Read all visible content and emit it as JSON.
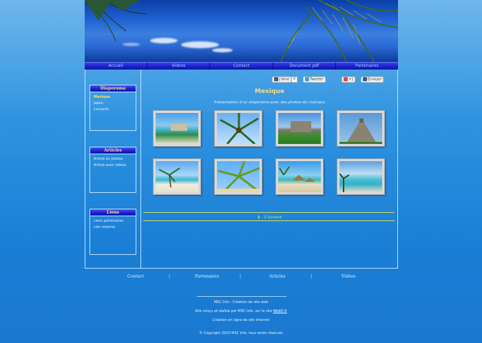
{
  "nav": [
    "Accueil",
    "Videos",
    "Contact",
    "Document pdf",
    "Partenaires"
  ],
  "sidebar": [
    {
      "title": "Diaporama",
      "items": [
        "Mexique",
        "Japon",
        "Concerts"
      ],
      "active": 0
    },
    {
      "title": "Articles",
      "items": [
        "Article en photos",
        "Article avec vidéos"
      ],
      "active": -1
    },
    {
      "title": "Liens",
      "items": [
        "Liens partenaires",
        "Lien externe"
      ],
      "active": -1
    }
  ],
  "social": {
    "like": "J'aime",
    "like_count": "0",
    "tweet": "Tweeter",
    "plusone": "+1",
    "send": "Envoyer"
  },
  "main": {
    "title": "Mexique",
    "subtitle": "Présentation d'un diaporama avec des photos du mexique"
  },
  "gallery": [
    "beach-ruins",
    "palm-tree",
    "ruins-lawn",
    "pyramid",
    "beach-palm",
    "palm-sky",
    "beach-huts",
    "turquoise-sea"
  ],
  "pager": {
    "current": "1",
    "sep": " - ",
    "next_num": "2",
    "next_label": "Suivant"
  },
  "footer": {
    "links": [
      "Contact",
      "Partenaires",
      "Articles",
      "Vidéos"
    ],
    "separator": "|",
    "line1": "MSC Info - Création de site web",
    "line2_prefix": "Site conçu et réalisé par MSC Info, sur le site ",
    "line2_link": "WebD.fr",
    "line3": "Création en ligne de site Internet",
    "line4": "© Copyright 2010 MSC Info. tous droits réservés"
  }
}
